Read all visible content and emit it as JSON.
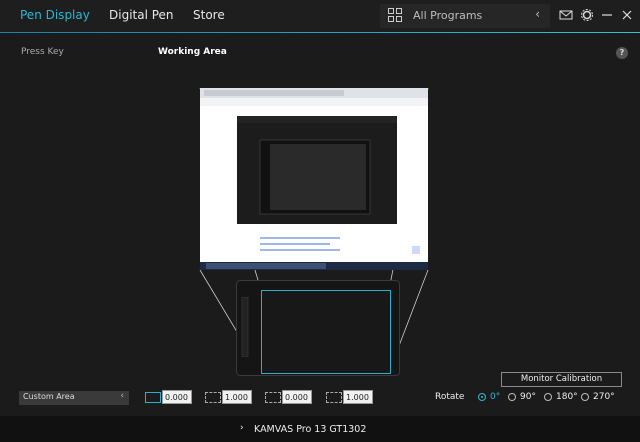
{
  "nav": {
    "tabs": [
      {
        "label": "Pen Display",
        "active": true
      },
      {
        "label": "Digital Pen",
        "active": false
      },
      {
        "label": "Store",
        "active": false
      }
    ],
    "programs": {
      "label": "All Programs",
      "icon": "apps-grid-icon"
    },
    "icons": [
      "mail-icon",
      "gear-icon",
      "minimize-icon",
      "close-icon"
    ]
  },
  "subheader": {
    "press_key": "Press Key",
    "working_area": "Working Area",
    "help": "?"
  },
  "mapping": {
    "area_select": "Custom Area",
    "fields": [
      "0.000",
      "1.000",
      "0.000",
      "1.000"
    ],
    "monitor_calibration": "Monitor Calibration",
    "rotate_label": "Rotate",
    "rotate_options": [
      "0°",
      "90°",
      "180°",
      "270°"
    ],
    "rotate_selected": "0°"
  },
  "footer": {
    "device": "KAMVAS Pro 13 GT1302"
  },
  "colors": {
    "accent": "#27b9d6",
    "background": "#1b1b1c",
    "bar": "#111111"
  }
}
